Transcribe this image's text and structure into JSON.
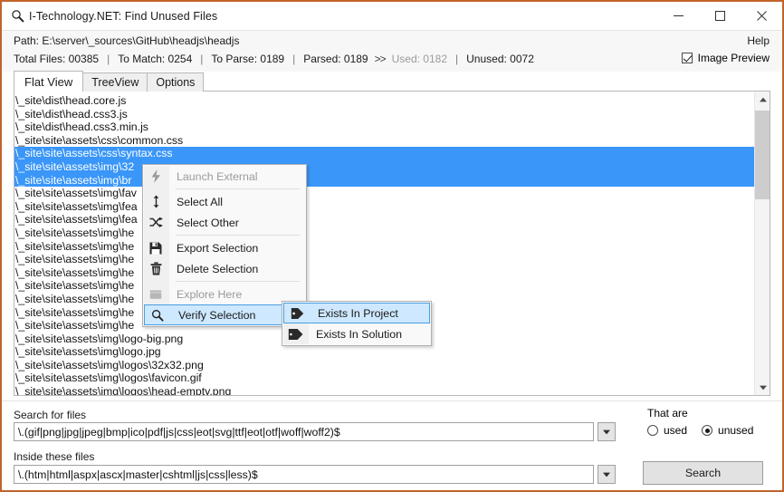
{
  "window": {
    "title": "I-Technology.NET: Find Unused Files",
    "title_icon": "magnifier-icon",
    "minimize_label": "—",
    "maximize_label": "☐",
    "close_label": "✕",
    "border_color": "#c0642b"
  },
  "header": {
    "path_label": "Path: E:\\server\\_sources\\GitHub\\headjs\\headjs",
    "help_label": "Help",
    "stats": [
      {
        "label": "Total Files: 00385",
        "dim": false
      },
      {
        "label": "To Match: 0254",
        "dim": false
      },
      {
        "label": "To Parse: 0189",
        "dim": false
      },
      {
        "label": "Parsed: 0189",
        "dim": false
      },
      {
        "label": "Used: 0182",
        "dim": true
      },
      {
        "label": "Unused: 0072",
        "dim": false
      }
    ],
    "separator": "|",
    "arrows": ">>",
    "image_preview_label": "Image Preview",
    "image_preview_checked": true
  },
  "tabs": [
    {
      "label": "Flat View",
      "active": true
    },
    {
      "label": "TreeView",
      "active": false
    },
    {
      "label": "Options",
      "active": false
    }
  ],
  "file_list": {
    "selection_color": "#3a96f8",
    "rows": [
      {
        "text": "\\_site\\dist\\head.core.js",
        "selected": false
      },
      {
        "text": "\\_site\\dist\\head.css3.js",
        "selected": false
      },
      {
        "text": "\\_site\\dist\\head.css3.min.js",
        "selected": false
      },
      {
        "text": "\\_site\\site\\assets\\css\\common.css",
        "selected": false
      },
      {
        "text": "\\_site\\site\\assets\\css\\syntax.css",
        "selected": true
      },
      {
        "text": "\\_site\\site\\assets\\img\\32",
        "selected": true
      },
      {
        "text": "\\_site\\site\\assets\\img\\br",
        "selected": true
      },
      {
        "text": "\\_site\\site\\assets\\img\\fav",
        "selected": false
      },
      {
        "text": "\\_site\\site\\assets\\img\\fea",
        "selected": false
      },
      {
        "text": "\\_site\\site\\assets\\img\\fea",
        "selected": false
      },
      {
        "text": "\\_site\\site\\assets\\img\\he",
        "selected": false
      },
      {
        "text": "\\_site\\site\\assets\\img\\he",
        "selected": false
      },
      {
        "text": "\\_site\\site\\assets\\img\\he",
        "selected": false
      },
      {
        "text": "\\_site\\site\\assets\\img\\he",
        "selected": false
      },
      {
        "text": "\\_site\\site\\assets\\img\\he",
        "selected": false
      },
      {
        "text": "\\_site\\site\\assets\\img\\he",
        "selected": false
      },
      {
        "text": "\\_site\\site\\assets\\img\\he",
        "selected": false
      },
      {
        "text": "\\_site\\site\\assets\\img\\he",
        "selected": false
      },
      {
        "text": "\\_site\\site\\assets\\img\\logo-big.png",
        "selected": false
      },
      {
        "text": "\\_site\\site\\assets\\img\\logo.jpg",
        "selected": false
      },
      {
        "text": "\\_site\\site\\assets\\img\\logos\\32x32.png",
        "selected": false
      },
      {
        "text": "\\_site\\site\\assets\\img\\logos\\favicon.gif",
        "selected": false
      },
      {
        "text": "\\_site\\site\\assets\\img\\logos\\head-empty.png",
        "selected": false
      }
    ]
  },
  "scrollbar": {
    "up_glyph": "▲",
    "down_glyph": "▼"
  },
  "context_menu": {
    "items": [
      {
        "label": "Launch External",
        "icon": "lightning-icon",
        "icon_glyph": "⚡",
        "disabled": true,
        "highlighted": false,
        "submenu": false
      },
      {
        "separator": true
      },
      {
        "label": "Select All",
        "icon": "updown-arrow-icon",
        "icon_glyph": "↕",
        "disabled": false,
        "highlighted": false,
        "submenu": false
      },
      {
        "label": "Select Other",
        "icon": "shuffle-icon",
        "icon_glyph": "⇄",
        "disabled": false,
        "highlighted": false,
        "submenu": false
      },
      {
        "separator": true
      },
      {
        "label": "Export Selection",
        "icon": "floppy-save-icon",
        "icon_glyph": "💾",
        "disabled": false,
        "highlighted": false,
        "submenu": false
      },
      {
        "label": "Delete Selection",
        "icon": "trash-icon",
        "icon_glyph": "🗑",
        "disabled": false,
        "highlighted": false,
        "submenu": false
      },
      {
        "separator": true
      },
      {
        "label": "Explore Here",
        "icon": "folder-icon",
        "icon_glyph": "🗀",
        "disabled": true,
        "highlighted": false,
        "submenu": false
      },
      {
        "label": "Verify Selection",
        "icon": "magnifier-icon",
        "icon_glyph": "🔍",
        "disabled": false,
        "highlighted": true,
        "submenu": true,
        "submenu_arrow": "▶"
      }
    ],
    "highlight_color": "#cde8ff",
    "highlight_border": "#4a9fe0"
  },
  "context_submenu": {
    "items": [
      {
        "label": "Exists In Project",
        "icon": "tag-icon",
        "highlighted": true
      },
      {
        "label": "Exists In Solution",
        "icon": "tags-icon",
        "highlighted": false
      }
    ]
  },
  "bottom": {
    "search_for_files_label": "Search for files",
    "search_for_files_value": "\\.(gif|png|jpg|jpeg|bmp|ico|pdf|js|css|eot|svg|ttf|eot|otf|woff|woff2)$",
    "inside_these_files_label": "Inside these files",
    "inside_these_files_value": "\\.(htm|html|aspx|ascx|master|cshtml|js|css|less)$",
    "combo_arrow": "▼",
    "that_are_label": "That are",
    "radio_used_label": "used",
    "radio_unused_label": "unused",
    "radio_selected": "unused",
    "search_button_label": "Search"
  }
}
